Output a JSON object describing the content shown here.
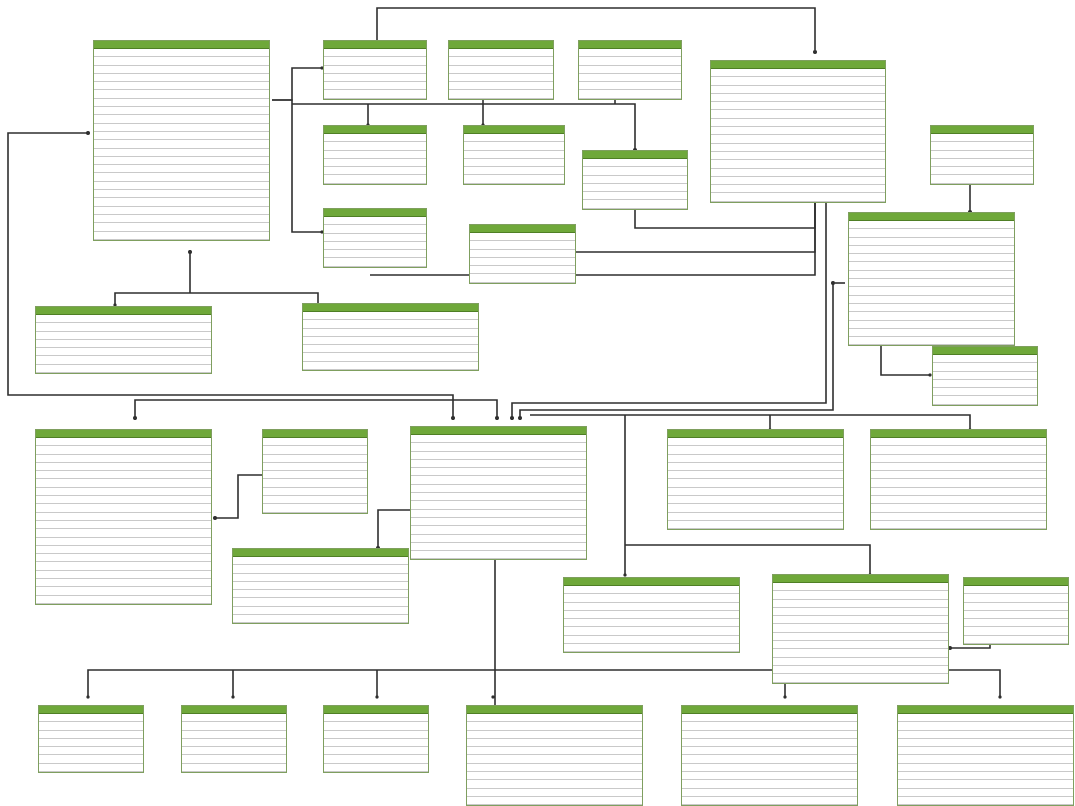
{
  "colors": {
    "header_bg": "#6fa83a",
    "header_text": "#ffffff",
    "line": "#2f2f2f",
    "primary_key": "#d23b1e",
    "foreign_key": "#3a6fb0"
  },
  "diagram": {
    "type": "entity-relationship",
    "table_count": 28,
    "note": ""
  }
}
